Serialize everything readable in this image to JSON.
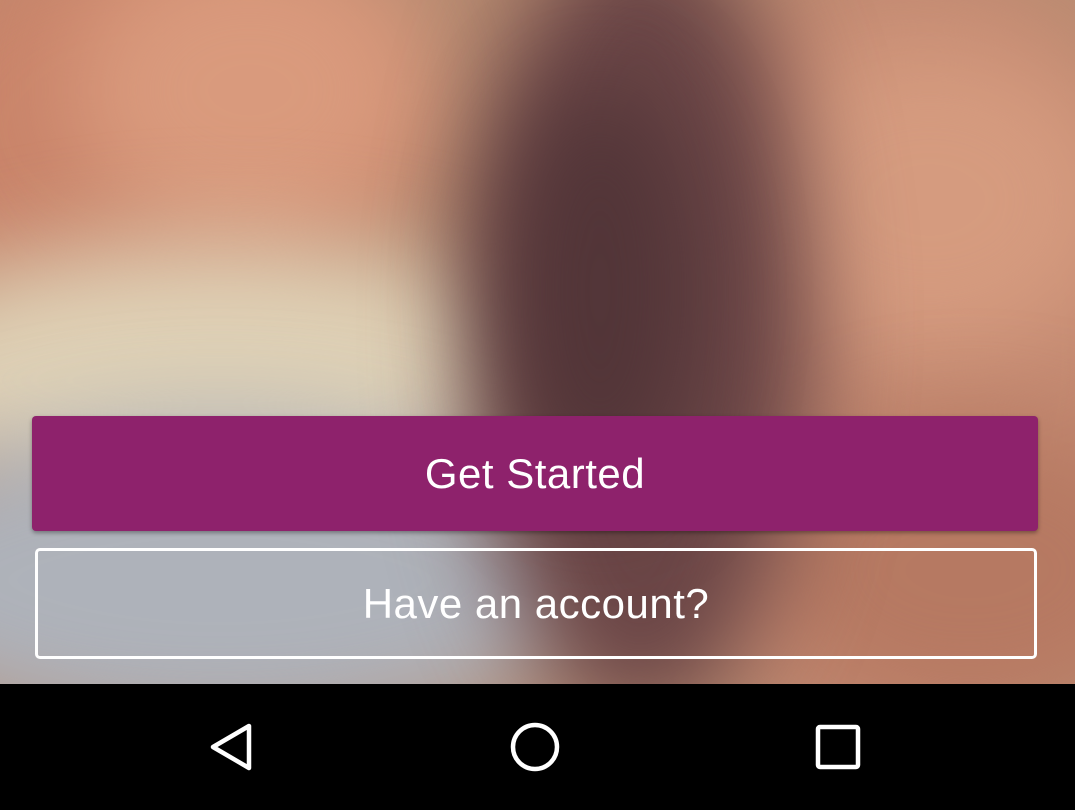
{
  "background": {
    "description_icon": "blurred-video-background"
  },
  "actions": {
    "get_started_label": "Get Started",
    "have_account_label": "Have an account?"
  },
  "navigation_bar": {
    "back_icon": "back-triangle-icon",
    "home_icon": "home-circle-icon",
    "recents_icon": "recents-square-icon"
  },
  "colors": {
    "primary_button": "#8e226c",
    "button_text": "#ffffff",
    "outline_border": "#ffffff",
    "nav_background": "#000000",
    "nav_icon": "#ffffff"
  }
}
